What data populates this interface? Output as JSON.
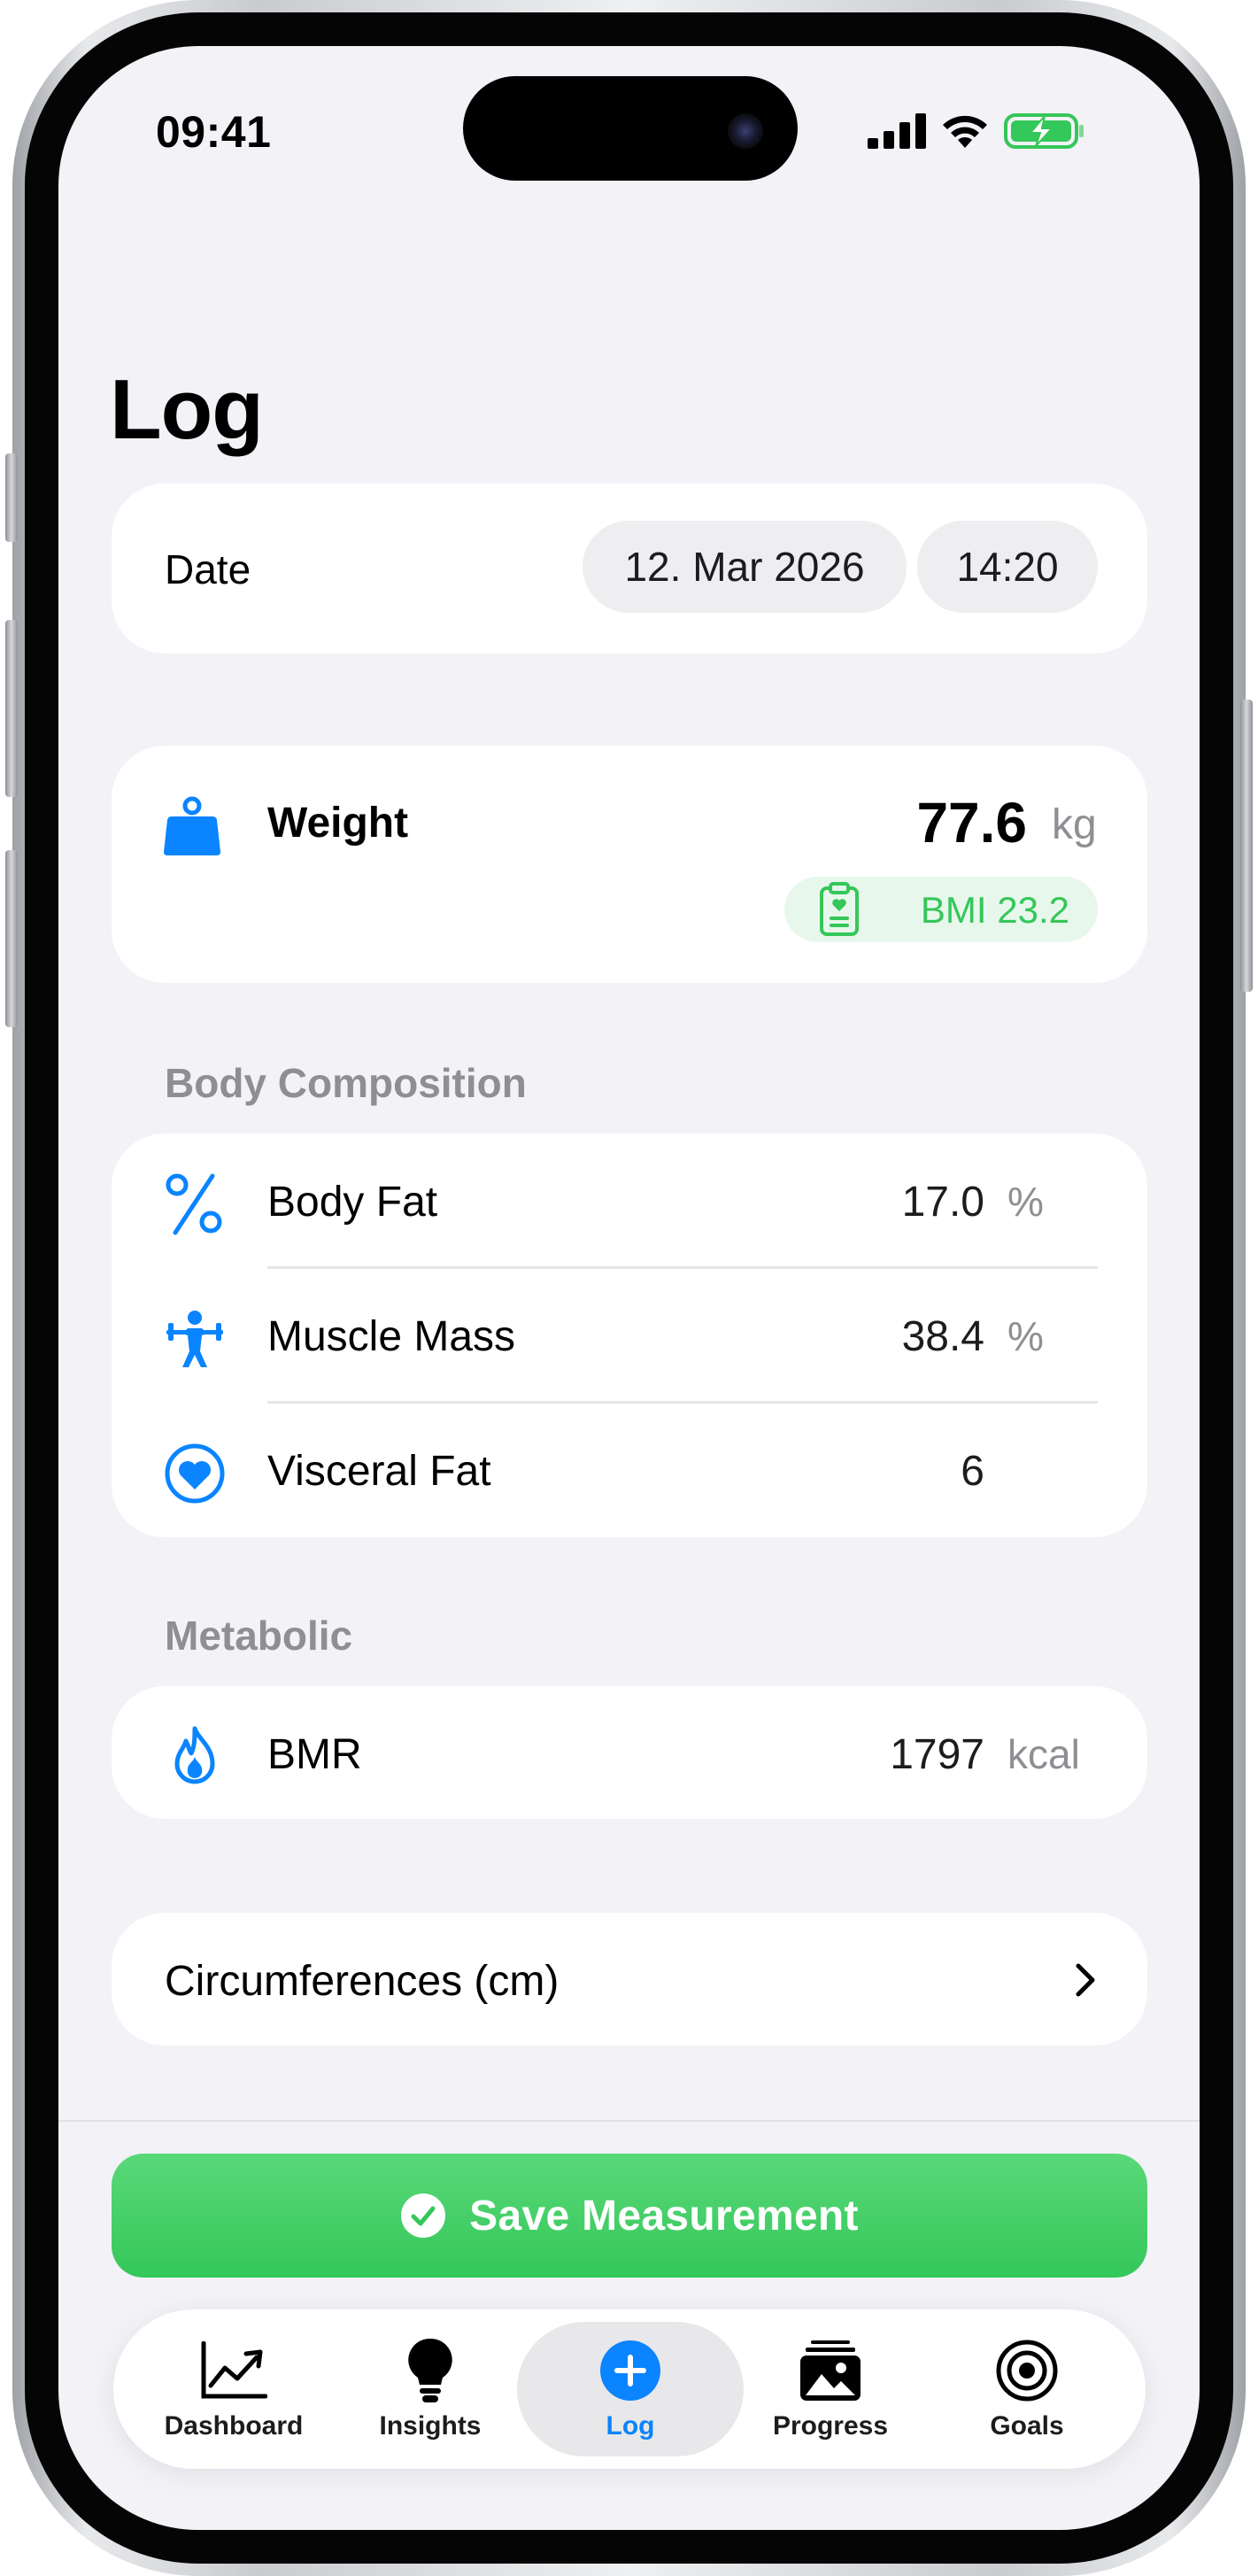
{
  "status_bar": {
    "time": "09:41",
    "icons": [
      "cellular-signal-icon",
      "wifi-icon",
      "battery-charging-icon"
    ]
  },
  "title": "Log",
  "date_row": {
    "label": "Date",
    "date": "12. Mar 2026",
    "time": "14:20"
  },
  "weight": {
    "label": "Weight",
    "value": "77.6",
    "unit": "kg",
    "bmi": "BMI 23.2",
    "icon": "weight-icon"
  },
  "body_composition": {
    "header": "Body Composition",
    "rows": [
      {
        "label": "Body Fat",
        "value": "17.0",
        "unit": "%",
        "icon": "percent-icon"
      },
      {
        "label": "Muscle Mass",
        "value": "38.4",
        "unit": "%",
        "icon": "weightlifter-icon"
      },
      {
        "label": "Visceral Fat",
        "value": "6",
        "unit": "",
        "icon": "heart-circle-icon"
      }
    ]
  },
  "metabolic": {
    "header": "Metabolic",
    "rows": [
      {
        "label": "BMR",
        "value": "1797",
        "unit": "kcal",
        "icon": "flame-icon"
      }
    ]
  },
  "circumferences": {
    "label": "Circumferences (cm)"
  },
  "save_button": {
    "label": "Save Measurement"
  },
  "tabs": [
    {
      "label": "Dashboard",
      "icon": "chart-line-icon",
      "active": false
    },
    {
      "label": "Insights",
      "icon": "lightbulb-icon",
      "active": false
    },
    {
      "label": "Log",
      "icon": "plus-circle-icon",
      "active": true
    },
    {
      "label": "Progress",
      "icon": "photo-stack-icon",
      "active": false
    },
    {
      "label": "Goals",
      "icon": "target-icon",
      "active": false
    }
  ],
  "colors": {
    "accent": "#0a84ff",
    "green": "#34c759",
    "secondary_text": "#8e8e93",
    "background": "#f2f2f7"
  }
}
